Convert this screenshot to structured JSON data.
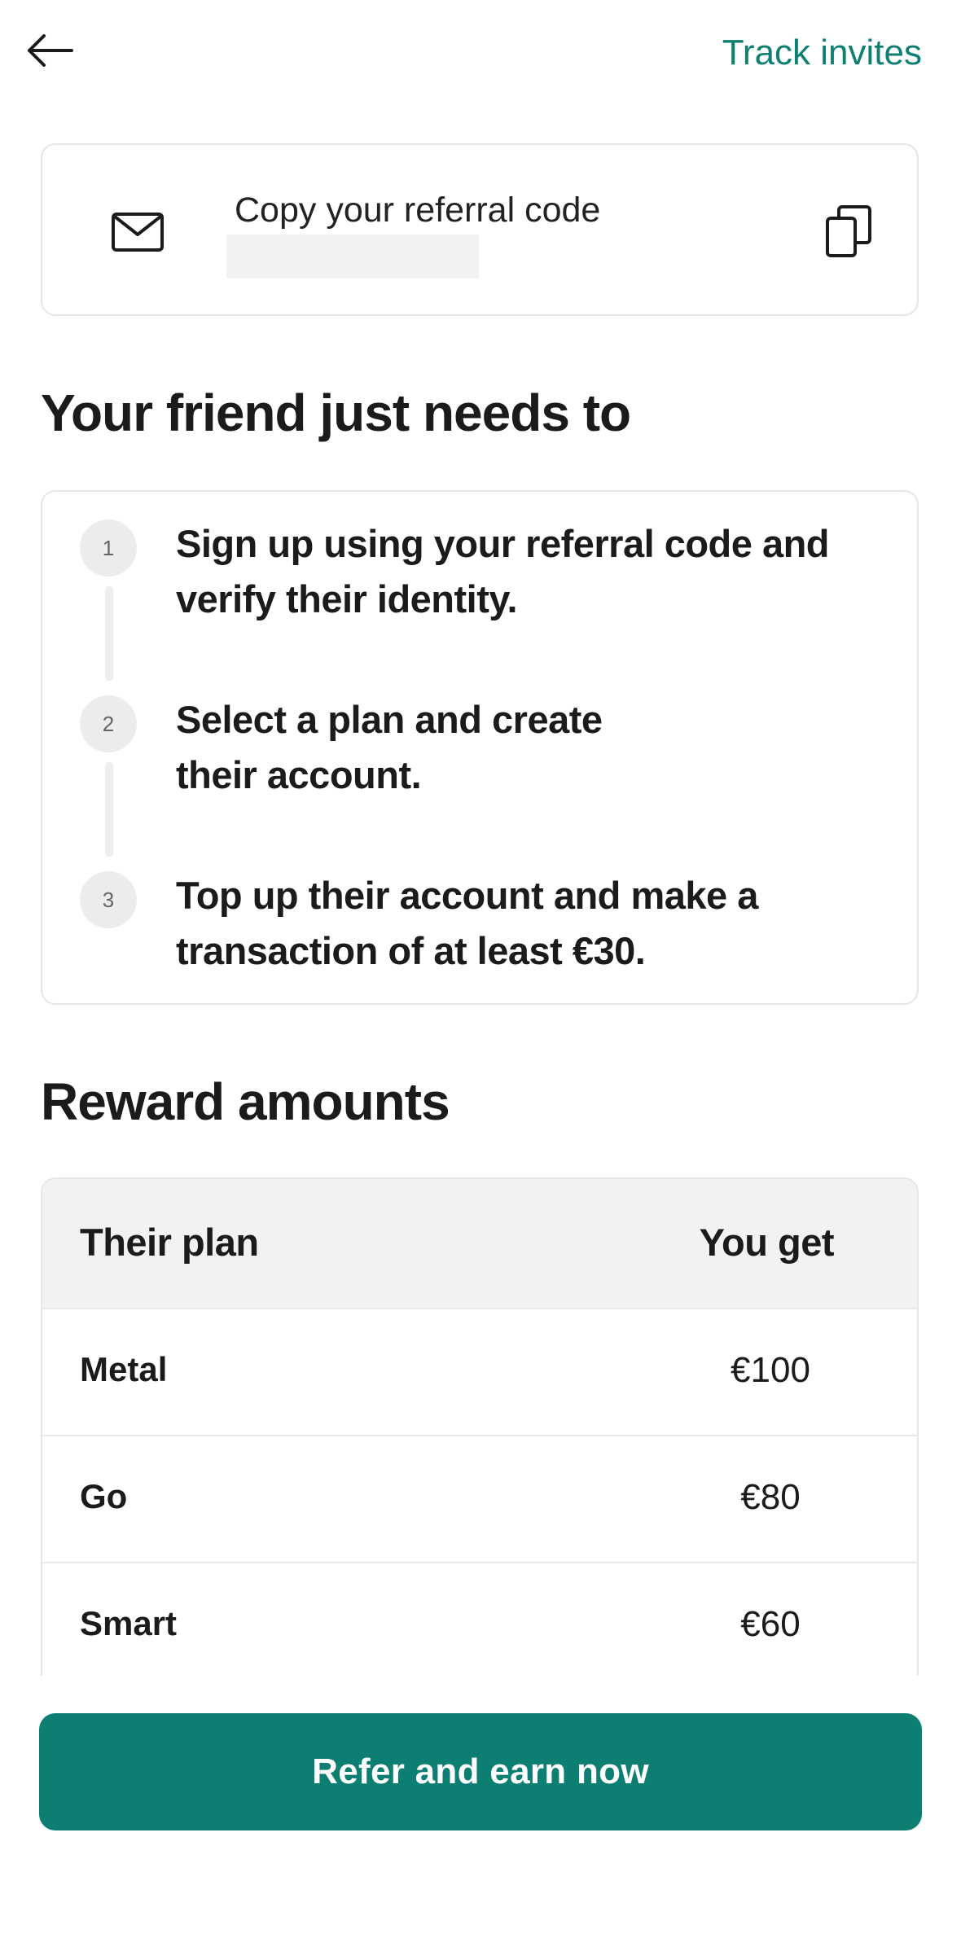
{
  "header": {
    "back_icon": "arrow-left-icon",
    "track_invites_label": "Track invites",
    "accent_color": "#0f7f72"
  },
  "referral_card": {
    "label": "Copy your referral code",
    "code_value": "",
    "mail_icon": "envelope-icon",
    "copy_icon": "copy-icon"
  },
  "steps_section": {
    "title": "Your friend just needs to",
    "steps": [
      {
        "number": "1",
        "text": "Sign up using your referral code and verify their identity."
      },
      {
        "number": "2",
        "text": "Select a plan and create their account."
      },
      {
        "number": "3",
        "text": "Top up their account and make a transaction of at least €30."
      }
    ]
  },
  "rewards_section": {
    "title": "Reward amounts",
    "columns": [
      "Their plan",
      "You get"
    ],
    "rows": [
      {
        "plan": "Metal",
        "amount": "€100"
      },
      {
        "plan": "Go",
        "amount": "€80"
      },
      {
        "plan": "Smart",
        "amount": "€60"
      }
    ]
  },
  "cta": {
    "label": "Refer and earn now",
    "color": "#0d7e72"
  }
}
